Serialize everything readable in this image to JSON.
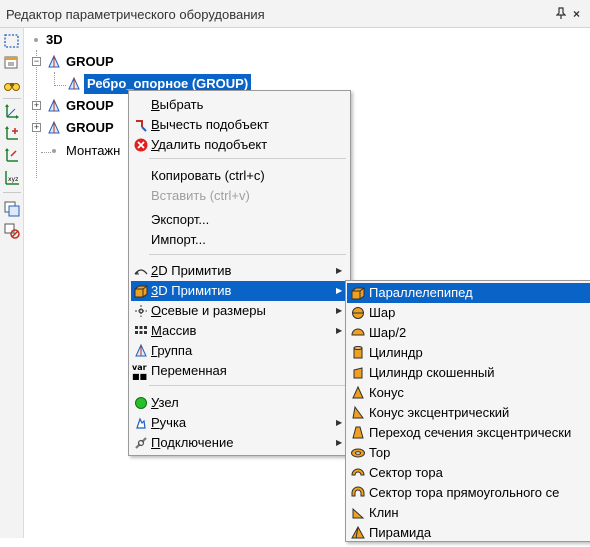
{
  "window": {
    "title": "Редактор параметрического оборудования",
    "pin_glyph": "ᵖ",
    "close_glyph": "×"
  },
  "toolbar": {
    "tools": [
      "select-icon",
      "properties-icon",
      "find-icon",
      "axis-icon",
      "axis-plus-icon",
      "axis-y-icon",
      "xyz-icon",
      "copy-icon",
      "link-icon"
    ]
  },
  "tree": {
    "root_label": "3D",
    "group1_label": "GROUP",
    "selected_label": "Ребро_опорное (GROUP)",
    "group2_label": "GROUP",
    "group3_label": "GROUP",
    "mount_label": "Монтажн"
  },
  "context_menu": {
    "select_ul": "В",
    "select_rest": "ыбрать",
    "subtract_ul": "В",
    "subtract_rest": "ычесть подобъект",
    "delete_ul": "У",
    "delete_rest": "далить подобъект",
    "copy": "Копировать (ctrl+c)",
    "paste": "Вставить (ctrl+v)",
    "export": "Экспорт...",
    "import": "Импорт...",
    "prim2d_ul": "2",
    "prim2d_rest": "D Примитив",
    "prim3d_ul": "3",
    "prim3d_rest": "D Примитив",
    "axes_ul": "О",
    "axes_rest": "севые и размеры",
    "array_ul": "М",
    "array_rest": "ассив",
    "group_ul": "Г",
    "group_rest": "руппа",
    "variable": "Переменная",
    "node_ul": "У",
    "node_rest": "зел",
    "handle_ul": "Р",
    "handle_rest": "учка",
    "connection_ul": "П",
    "connection_rest": "одключение"
  },
  "submenu_3d": {
    "items": [
      "Параллелепипед",
      "Шар",
      "Шар/2",
      "Цилиндр",
      "Цилиндр скошенный",
      "Конус",
      "Конус эксцентрический",
      "Переход сечения эксцентрически",
      "Тор",
      "Сектор тора",
      "Сектор тора прямоугольного се",
      "Клин",
      "Пирамида"
    ]
  },
  "colors": {
    "highlight": "#0a64c8",
    "primitive_orange": "#f0a020"
  }
}
